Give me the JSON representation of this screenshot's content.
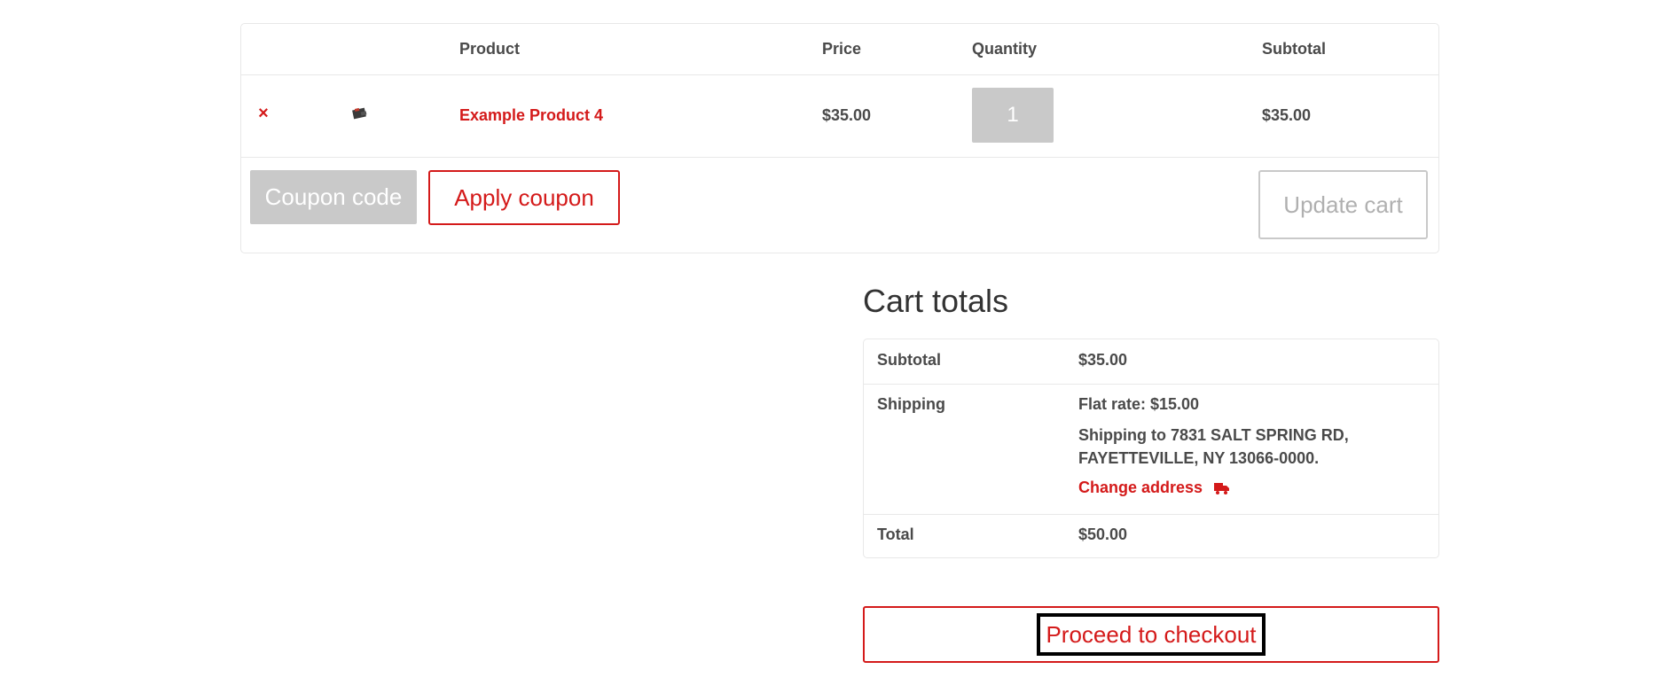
{
  "cart": {
    "headers": {
      "product": "Product",
      "price": "Price",
      "quantity": "Quantity",
      "subtotal": "Subtotal"
    },
    "items": [
      {
        "remove_symbol": "×",
        "thumbnail_icon": "product-thumbnail-icon",
        "name": "Example Product 4",
        "price": "$35.00",
        "quantity": "1",
        "subtotal": "$35.00"
      }
    ],
    "coupon_placeholder": "Coupon code",
    "apply_coupon_label": "Apply coupon",
    "update_cart_label": "Update cart"
  },
  "totals": {
    "title": "Cart totals",
    "subtotal_label": "Subtotal",
    "subtotal_value": "$35.00",
    "shipping_label": "Shipping",
    "shipping_method": "Flat rate: $15.00",
    "shipping_to_line1": "Shipping to 7831 SALT SPRING RD,",
    "shipping_to_line2": "FAYETTEVILLE, NY 13066-0000.",
    "change_address_label": "Change address",
    "change_address_icon": "truck-icon",
    "total_label": "Total",
    "total_value": "$50.00"
  },
  "checkout": {
    "label": "Proceed to checkout"
  },
  "colors": {
    "accent": "#d41a1a",
    "text": "#4a4a4a",
    "border": "#e8e8e8",
    "muted_input": "#c9c9c9"
  }
}
